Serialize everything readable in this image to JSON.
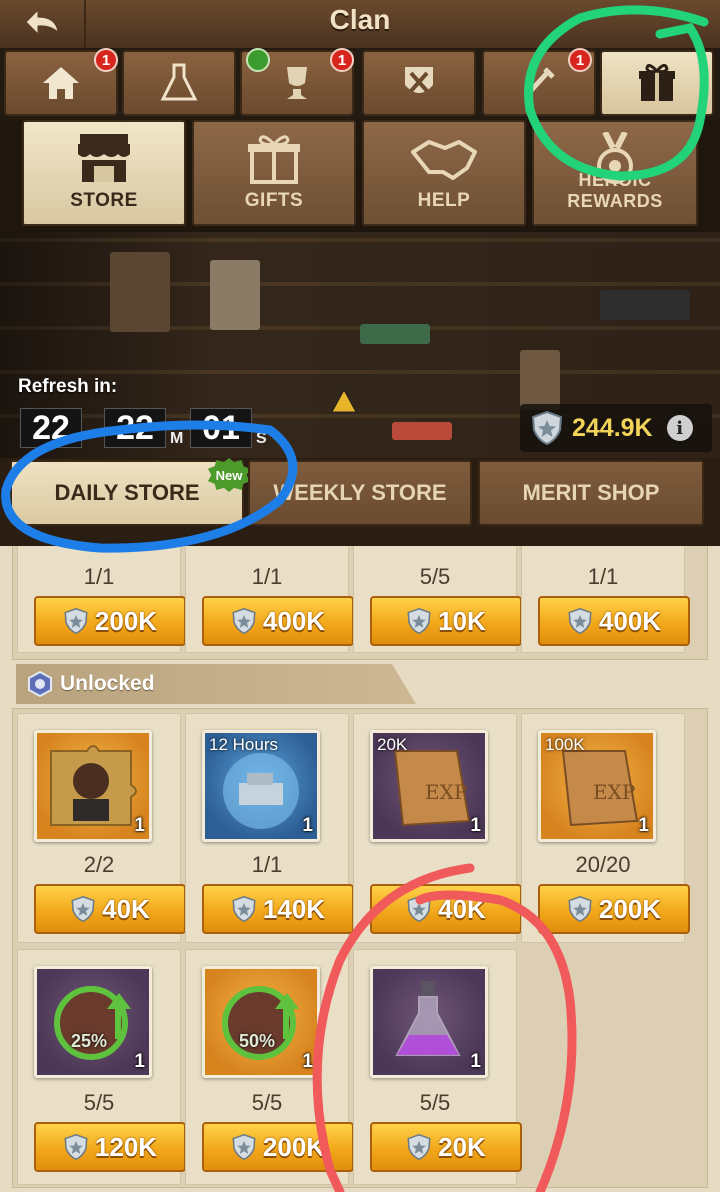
{
  "header": {
    "title": "Clan",
    "back_icon": "back-arrow-icon"
  },
  "top_tabs": [
    {
      "icon": "home-icon",
      "badge": "1"
    },
    {
      "icon": "flask-icon",
      "badge": ""
    },
    {
      "icon": "trophy-icon",
      "badge": "1",
      "hammer_badge": true
    },
    {
      "icon": "tools-icon",
      "badge": ""
    },
    {
      "icon": "wrench-icon",
      "badge": "1"
    },
    {
      "icon": "gift-icon",
      "badge": "",
      "active": true
    }
  ],
  "sub_tabs": [
    {
      "label": "STORE",
      "icon": "store-icon",
      "active": true
    },
    {
      "label": "GIFTS",
      "icon": "gift-box-icon"
    },
    {
      "label": "HELP",
      "icon": "handshake-icon"
    },
    {
      "label": "HEROIC REWARDS",
      "icon": "medal-icon"
    }
  ],
  "banner": {
    "refresh_label": "Refresh in:",
    "timer": {
      "hours": "22",
      "minutes": "22",
      "minutes_unit": "M",
      "seconds": "01",
      "seconds_unit": "S"
    },
    "currency_value": "244.9K",
    "currency_icon": "shield-coin-icon",
    "info_label": "i"
  },
  "store_tabs": [
    {
      "label": "DAILY STORE",
      "active": true,
      "new_badge": "New"
    },
    {
      "label": "WEEKLY STORE"
    },
    {
      "label": "MERIT SHOP"
    }
  ],
  "top_row": [
    {
      "stock": "1/1",
      "price": "200K"
    },
    {
      "stock": "1/1",
      "price": "400K"
    },
    {
      "stock": "5/5",
      "price": "10K"
    },
    {
      "stock": "1/1",
      "price": "400K"
    }
  ],
  "section": {
    "title": "Unlocked",
    "icon": "unlock-badge-icon"
  },
  "items_row1": [
    {
      "name": "hero-puzzle",
      "tag": "",
      "qty": "1",
      "stock": "2/2",
      "price": "40K",
      "bg": "orange"
    },
    {
      "name": "time-boost",
      "tag": "12 Hours",
      "qty": "1",
      "stock": "1/1",
      "price": "140K",
      "bg": "blue"
    },
    {
      "name": "exp-book",
      "tag": "20K",
      "qty": "1",
      "stock": "",
      "price": "40K",
      "bg": "purple"
    },
    {
      "name": "exp-book",
      "tag": "100K",
      "qty": "1",
      "stock": "20/20",
      "price": "200K",
      "bg": "orange"
    }
  ],
  "items_row2": [
    {
      "name": "speedup-25",
      "tag": "25%",
      "qty": "1",
      "stock": "5/5",
      "price": "120K",
      "bg": "purple"
    },
    {
      "name": "speedup-50",
      "tag": "50%",
      "qty": "1",
      "stock": "5/5",
      "price": "200K",
      "bg": "orange"
    },
    {
      "name": "potion-flask",
      "tag": "",
      "qty": "1",
      "stock": "5/5",
      "price": "20K",
      "bg": "purple"
    }
  ]
}
